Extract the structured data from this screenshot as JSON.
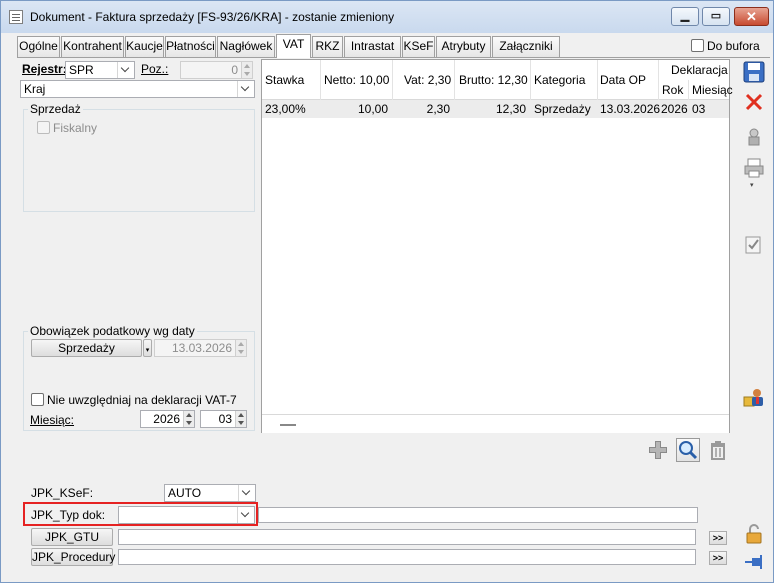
{
  "window": {
    "title": "Dokument - Faktura sprzedaży [FS-93/26/KRA]  - zostanie zmieniony"
  },
  "tabs": [
    {
      "label": "Ogólne"
    },
    {
      "label": "Kontrahent"
    },
    {
      "label": "Kaucje"
    },
    {
      "label": "Płatności"
    },
    {
      "label": "Nagłówek"
    },
    {
      "label": "VAT",
      "active": true
    },
    {
      "label": "RKZ"
    },
    {
      "label": "Intrastat"
    },
    {
      "label": "KSeF"
    },
    {
      "label": "Atrybuty"
    },
    {
      "label": "Załączniki"
    }
  ],
  "do_bufora": {
    "label": "Do bufora",
    "checked": false
  },
  "left": {
    "rejestr_label": "Rejestr:",
    "rejestr_value": "SPR",
    "poz_label": "Poz.:",
    "poz_value": "0",
    "kraj_value": "Kraj",
    "sprzedaz_group": "Sprzedaż",
    "fiskalny_label": "Fiskalny",
    "obowiazek_group": "Obowiązek podatkowy wg daty",
    "obowiazek_button": "Sprzedaży",
    "obowiazek_date": "13.03.2026",
    "nie_uwzgledniaj_label": "Nie uwzględniaj na deklaracji VAT-7",
    "miesiac_label": "Miesiąc:",
    "miesiac_year": "2026",
    "miesiac_month": "03"
  },
  "grid": {
    "headers": {
      "stawka": "Stawka",
      "netto": "Netto: 10,00",
      "vat": "Vat: 2,30",
      "brutto": "Brutto: 12,30",
      "kategoria": "Kategoria",
      "data_op": "Data OP",
      "deklaracja": "Deklaracja",
      "rok": "Rok",
      "miesiac": "Miesiąc"
    },
    "rows": [
      {
        "stawka": "23,00%",
        "netto": "10,00",
        "vat": "2,30",
        "brutto": "12,30",
        "kategoria": "Sprzedaży",
        "data_op": "13.03.2026",
        "rok": "2026",
        "miesiac": "03"
      }
    ]
  },
  "jpk": {
    "ksef_label": "JPK_KSeF:",
    "ksef_value": "AUTO",
    "typ_dok_label": "JPK_Typ dok:",
    "typ_dok_value": "",
    "gtu_button": "JPK_GTU",
    "procedury_button": "JPK_Procedury",
    "more_label": ">>"
  },
  "icons": {
    "save": "save-icon",
    "cancel": "close-icon",
    "delete": "trash-icon",
    "add": "plus-icon",
    "search": "magnifier-icon"
  }
}
